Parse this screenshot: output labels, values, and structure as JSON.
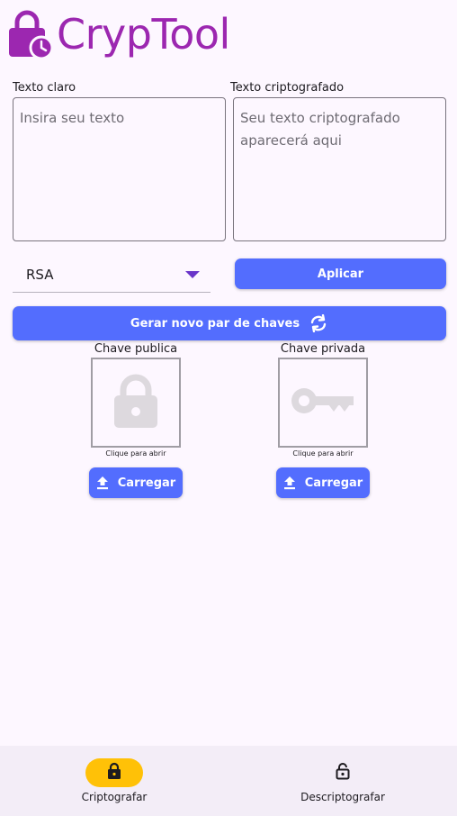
{
  "app": {
    "title": "CrypTool",
    "brand_color": "#9c27b0"
  },
  "plain_text": {
    "label": "Texto claro",
    "placeholder": "Insira seu texto",
    "value": ""
  },
  "cipher_text": {
    "label": "Texto criptografado",
    "placeholder": "Seu texto criptografado aparecerá aqui",
    "value": ""
  },
  "algorithm": {
    "selected": "RSA"
  },
  "actions": {
    "apply_label": "Aplicar",
    "generate_keys_label": "Gerar novo par de chaves",
    "accent": "#536dfe"
  },
  "keys": {
    "public": {
      "title": "Chave publica",
      "hint": "Clique para abrir",
      "upload_label": "Carregar",
      "icon": "lock-icon"
    },
    "private": {
      "title": "Chave privada",
      "hint": "Clique para abrir",
      "upload_label": "Carregar",
      "icon": "key-icon"
    }
  },
  "nav": {
    "items": [
      {
        "label": "Criptografar",
        "icon": "lock-icon",
        "active": true
      },
      {
        "label": "Descriptografar",
        "icon": "lock-open-icon",
        "active": false
      }
    ],
    "active_color": "#ffc107"
  }
}
